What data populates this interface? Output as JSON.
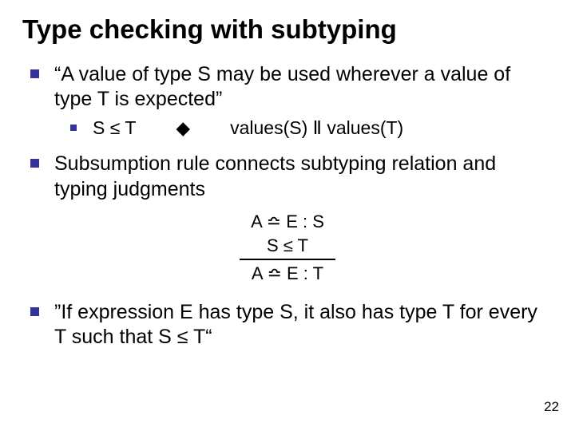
{
  "title": "Type checking with subtyping",
  "bullets": {
    "quote": "“A value of type S may be used wherever a value of type T is expected”",
    "sub_left": "S ≤ T",
    "sub_arrow": "◆",
    "sub_right": "values(S) Ⅱ values(T)",
    "subsumption": "Subsumption rule connects subtyping relation and typing judgments",
    "conclusion": "”If expression E has type S, it also has type T for every T such that S ≤ T“"
  },
  "rule": {
    "line1": "A ≏ E : S",
    "line2": "S ≤ T",
    "line3": "A ≏ E : T"
  },
  "page": "22"
}
